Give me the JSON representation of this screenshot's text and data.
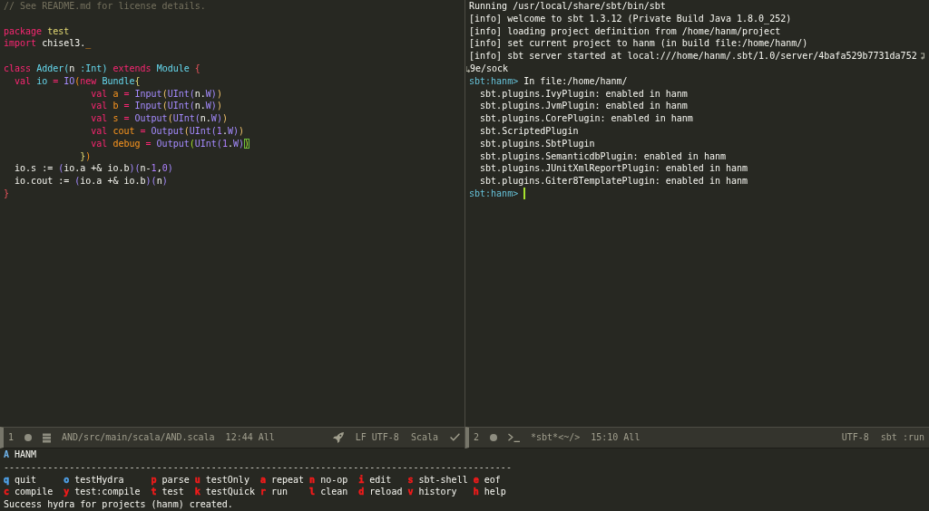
{
  "editor": {
    "lines": [
      {
        "kind": "code",
        "tokens": [
          {
            "text": "// See README.md for license details.",
            "kind": "comment"
          }
        ]
      },
      {
        "kind": "blank"
      },
      {
        "kind": "code",
        "tokens": [
          {
            "text": "package ",
            "kind": "keyword"
          },
          {
            "text": "test",
            "kind": "package"
          }
        ]
      },
      {
        "kind": "code",
        "tokens": [
          {
            "text": "import ",
            "kind": "keyword"
          },
          {
            "text": "chisel3.",
            "kind": "plain"
          },
          {
            "text": "_",
            "kind": "variable"
          }
        ]
      },
      {
        "kind": "blank"
      },
      {
        "kind": "code",
        "tokens": [
          {
            "text": "class ",
            "kind": "keyword"
          },
          {
            "text": "Adder",
            "kind": "entity"
          },
          {
            "text": "(",
            "kind": "delim6"
          },
          {
            "text": "n ",
            "kind": "plain"
          },
          {
            "text": ":Int",
            "kind": "entity"
          },
          {
            "text": ")",
            "kind": "delim6"
          },
          {
            "text": " extends ",
            "kind": "keyword"
          },
          {
            "text": "Module",
            "kind": "entity"
          },
          {
            "text": " {",
            "kind": "delim1"
          }
        ]
      },
      {
        "kind": "code",
        "tokens": [
          {
            "text": "  val ",
            "kind": "keyword"
          },
          {
            "text": "io",
            "kind": "entity"
          },
          {
            "text": " = ",
            "kind": "keyword"
          },
          {
            "text": "IO",
            "kind": "builtin"
          },
          {
            "text": "(",
            "kind": "delim2"
          },
          {
            "text": "new ",
            "kind": "keyword"
          },
          {
            "text": "Bundle",
            "kind": "entity"
          },
          {
            "text": "{",
            "kind": "delim3"
          }
        ]
      },
      {
        "kind": "code",
        "tokens": [
          {
            "text": "                val ",
            "kind": "keyword"
          },
          {
            "text": "a",
            "kind": "variable"
          },
          {
            "text": " = ",
            "kind": "keyword"
          },
          {
            "text": "Input",
            "kind": "builtin"
          },
          {
            "text": "(",
            "kind": "delim4"
          },
          {
            "text": "UInt",
            "kind": "builtin"
          },
          {
            "text": "(",
            "kind": "delim5"
          },
          {
            "text": "n.",
            "kind": "plain"
          },
          {
            "text": "W",
            "kind": "builtin"
          },
          {
            "text": ")",
            "kind": "delim5"
          },
          {
            "text": ")",
            "kind": "delim4"
          }
        ]
      },
      {
        "kind": "code",
        "tokens": [
          {
            "text": "                val ",
            "kind": "keyword"
          },
          {
            "text": "b",
            "kind": "variable"
          },
          {
            "text": " = ",
            "kind": "keyword"
          },
          {
            "text": "Input",
            "kind": "builtin"
          },
          {
            "text": "(",
            "kind": "delim4"
          },
          {
            "text": "UInt",
            "kind": "builtin"
          },
          {
            "text": "(",
            "kind": "delim5"
          },
          {
            "text": "n.",
            "kind": "plain"
          },
          {
            "text": "W",
            "kind": "builtin"
          },
          {
            "text": ")",
            "kind": "delim5"
          },
          {
            "text": ")",
            "kind": "delim4"
          }
        ]
      },
      {
        "kind": "code",
        "tokens": [
          {
            "text": "                val ",
            "kind": "keyword"
          },
          {
            "text": "s",
            "kind": "variable"
          },
          {
            "text": " = ",
            "kind": "keyword"
          },
          {
            "text": "Output",
            "kind": "builtin"
          },
          {
            "text": "(",
            "kind": "delim4"
          },
          {
            "text": "UInt",
            "kind": "builtin"
          },
          {
            "text": "(",
            "kind": "delim5"
          },
          {
            "text": "n.",
            "kind": "plain"
          },
          {
            "text": "W",
            "kind": "builtin"
          },
          {
            "text": ")",
            "kind": "delim5"
          },
          {
            "text": ")",
            "kind": "delim4"
          }
        ]
      },
      {
        "kind": "code",
        "tokens": [
          {
            "text": "                val ",
            "kind": "keyword"
          },
          {
            "text": "cout",
            "kind": "variable"
          },
          {
            "text": " = ",
            "kind": "keyword"
          },
          {
            "text": "Output",
            "kind": "builtin"
          },
          {
            "text": "(",
            "kind": "delim4"
          },
          {
            "text": "UInt",
            "kind": "builtin"
          },
          {
            "text": "(",
            "kind": "delim5"
          },
          {
            "text": "1",
            "kind": "number"
          },
          {
            "text": ".",
            "kind": "plain"
          },
          {
            "text": "W",
            "kind": "builtin"
          },
          {
            "text": ")",
            "kind": "delim5"
          },
          {
            "text": ")",
            "kind": "delim4"
          }
        ]
      },
      {
        "kind": "code",
        "tokens": [
          {
            "text": "                val ",
            "kind": "keyword"
          },
          {
            "text": "debug",
            "kind": "variable"
          },
          {
            "text": " = ",
            "kind": "keyword"
          },
          {
            "text": "Output",
            "kind": "builtin"
          },
          {
            "text": "(",
            "kind": "match"
          },
          {
            "text": "UInt",
            "kind": "builtin"
          },
          {
            "text": "(",
            "kind": "delim5"
          },
          {
            "text": "1",
            "kind": "number"
          },
          {
            "text": ".",
            "kind": "plain"
          },
          {
            "text": "W",
            "kind": "builtin"
          },
          {
            "text": ")",
            "kind": "delim5"
          },
          {
            "text": ")",
            "kind": "cursor"
          }
        ]
      },
      {
        "kind": "code",
        "tokens": [
          {
            "text": "              }",
            "kind": "delim3"
          },
          {
            "text": ")",
            "kind": "delim2"
          }
        ]
      },
      {
        "kind": "code",
        "tokens": [
          {
            "text": "  io.s := ",
            "kind": "plain"
          },
          {
            "text": "(",
            "kind": "delim5"
          },
          {
            "text": "io.a +& io.b",
            "kind": "plain"
          },
          {
            "text": ")",
            "kind": "delim5"
          },
          {
            "text": "(",
            "kind": "delim5"
          },
          {
            "text": "n-",
            "kind": "plain"
          },
          {
            "text": "1",
            "kind": "number"
          },
          {
            "text": ",",
            "kind": "plain"
          },
          {
            "text": "0",
            "kind": "number"
          },
          {
            "text": ")",
            "kind": "delim5"
          }
        ]
      },
      {
        "kind": "code",
        "tokens": [
          {
            "text": "  io.cout := ",
            "kind": "plain"
          },
          {
            "text": "(",
            "kind": "delim5"
          },
          {
            "text": "io.a +& io.b",
            "kind": "plain"
          },
          {
            "text": ")",
            "kind": "delim5"
          },
          {
            "text": "(",
            "kind": "delim5"
          },
          {
            "text": "n",
            "kind": "plain"
          },
          {
            "text": ")",
            "kind": "delim5"
          }
        ]
      },
      {
        "kind": "code",
        "tokens": [
          {
            "text": "}",
            "kind": "delim1"
          }
        ]
      }
    ],
    "modeline": {
      "window_number": "1",
      "file": "AND/src/main/scala/AND.scala",
      "position": "12:44 All",
      "encoding": "LF UTF-8",
      "mode": "Scala"
    }
  },
  "terminal": {
    "lines": [
      {
        "kind": "output",
        "text": "Running /usr/local/share/sbt/bin/sbt"
      },
      {
        "kind": "output",
        "text": "[info] welcome to sbt 1.3.12 (Private Build Java 1.8.0_252)"
      },
      {
        "kind": "output",
        "text": "[info] loading project definition from /home/hanm/project"
      },
      {
        "kind": "output",
        "text": "[info] set current project to hanm (in build file:/home/hanm/)"
      },
      {
        "kind": "wrapped",
        "text": "[info] sbt server started at local:///home/hanm/.sbt/1.0/server/4bafa529b7731da752"
      },
      {
        "kind": "continuation",
        "text": "9e/sock"
      },
      {
        "kind": "prompt",
        "prompt": "sbt:hanm>",
        "text": "In file:/home/hanm/"
      },
      {
        "kind": "output",
        "text": "  sbt.plugins.IvyPlugin: enabled in hanm"
      },
      {
        "kind": "output",
        "text": "  sbt.plugins.JvmPlugin: enabled in hanm"
      },
      {
        "kind": "output",
        "text": "  sbt.plugins.CorePlugin: enabled in hanm"
      },
      {
        "kind": "output",
        "text": "  sbt.ScriptedPlugin"
      },
      {
        "kind": "output",
        "text": "  sbt.plugins.SbtPlugin"
      },
      {
        "kind": "output",
        "text": "  sbt.plugins.SemanticdbPlugin: enabled in hanm"
      },
      {
        "kind": "output",
        "text": "  sbt.plugins.JUnitXmlReportPlugin: enabled in hanm"
      },
      {
        "kind": "output",
        "text": "  sbt.plugins.Giter8TemplatePlugin: enabled in hanm"
      },
      {
        "kind": "input",
        "prompt": "sbt:hanm>"
      }
    ],
    "modeline": {
      "window_number": "2",
      "buffer": "*sbt*<~/>",
      "position": "15:10 All",
      "encoding": "UTF-8",
      "mode": "sbt :run"
    }
  },
  "hydra": {
    "title_key": "A",
    "title": "HANM",
    "rule": "---------------------------------------------------------------------------------------------",
    "rows": [
      [
        {
          "key": "q",
          "label": "quit",
          "color": "#4fa1e8"
        },
        {
          "key": "o",
          "label": "testHydra",
          "color": "#4fa1e8"
        },
        {
          "key": "p",
          "label": "parse",
          "color": "#f21b1b"
        },
        {
          "key": "u",
          "label": "testOnly",
          "color": "#f21b1b"
        },
        {
          "key": "a",
          "label": "repeat",
          "color": "#f21b1b"
        },
        {
          "key": "n",
          "label": "no-op",
          "color": "#f21b1b"
        },
        {
          "key": "i",
          "label": "edit",
          "color": "#f21b1b"
        },
        {
          "key": "s",
          "label": "sbt-shell",
          "color": "#f21b1b"
        },
        {
          "key": "e",
          "label": "eof",
          "color": "#f21b1b"
        }
      ],
      [
        {
          "key": "c",
          "label": "compile",
          "color": "#f21b1b"
        },
        {
          "key": "y",
          "label": "test:compile",
          "color": "#f21b1b"
        },
        {
          "key": "t",
          "label": "test",
          "color": "#f21b1b"
        },
        {
          "key": "k",
          "label": "testQuick",
          "color": "#f21b1b"
        },
        {
          "key": "r",
          "label": "run",
          "color": "#f21b1b"
        },
        {
          "key": "l",
          "label": "clean",
          "color": "#f21b1b"
        },
        {
          "key": "d",
          "label": "reload",
          "color": "#f21b1b"
        },
        {
          "key": "v",
          "label": "history",
          "color": "#f21b1b"
        },
        {
          "key": "h",
          "label": "help",
          "color": "#f21b1b"
        }
      ]
    ]
  },
  "echo_area": "Success hydra for projects (hanm) created."
}
